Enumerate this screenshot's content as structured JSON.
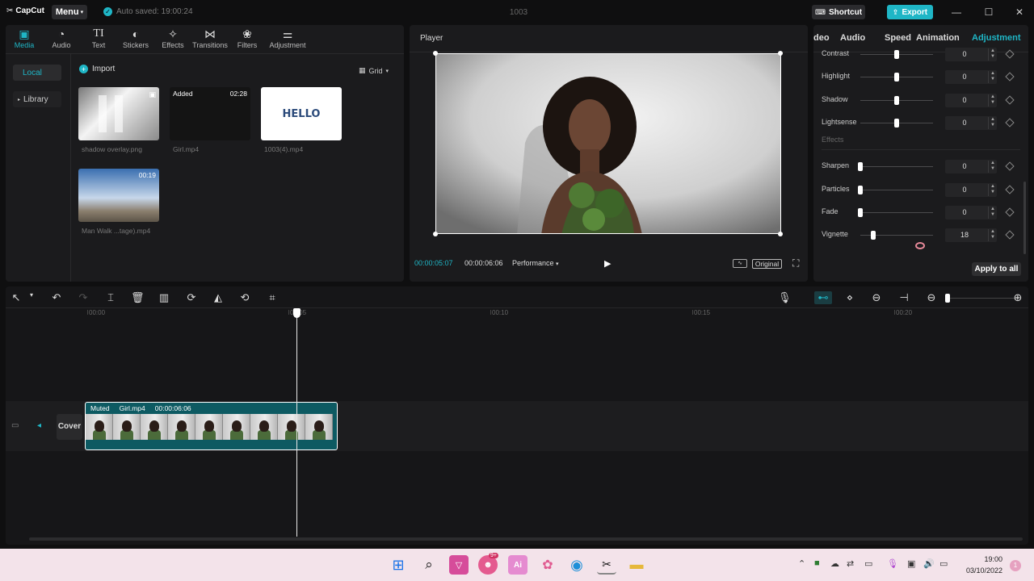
{
  "app": {
    "logo": "CapCut",
    "menu_label": "Menu",
    "autosave": "Auto saved: 19:00:24",
    "project_title": "1003",
    "shortcut_label": "Shortcut",
    "export_label": "Export"
  },
  "tool_tabs": [
    {
      "label": "Media",
      "icon": "media-icon",
      "active": true
    },
    {
      "label": "Audio",
      "icon": "audio-icon"
    },
    {
      "label": "Text",
      "icon": "text-icon"
    },
    {
      "label": "Stickers",
      "icon": "stickers-icon"
    },
    {
      "label": "Effects",
      "icon": "effects-icon"
    },
    {
      "label": "Transitions",
      "icon": "transitions-icon"
    },
    {
      "label": "Filters",
      "icon": "filters-icon"
    },
    {
      "label": "Adjustment",
      "icon": "adjustment-icon"
    }
  ],
  "media": {
    "side": [
      "Local",
      "Library"
    ],
    "import_label": "Import",
    "view_label": "Grid",
    "items": [
      {
        "name": "shadow overlay.png",
        "duration": "",
        "added": ""
      },
      {
        "name": "Girl.mp4",
        "duration": "02:28",
        "added": "Added"
      },
      {
        "name": "1003(4).mp4",
        "duration": "",
        "added": "",
        "text": "HELLO"
      },
      {
        "name": "Man Walk ...tage).mp4",
        "duration": "00:19",
        "added": ""
      }
    ]
  },
  "player": {
    "title": "Player",
    "current_time": "00:00:05:07",
    "total_time": "00:00:06:06",
    "performance_label": "Performance",
    "original_label": "Original"
  },
  "adjustment": {
    "tabs": [
      "deo",
      "Audio",
      "Speed",
      "Animation",
      "Adjustment"
    ],
    "active_tab": "Adjustment",
    "rows_top": [
      {
        "label": "Contrast",
        "value": "0",
        "level": 0.5
      },
      {
        "label": "Highlight",
        "value": "0",
        "level": 0.5
      },
      {
        "label": "Shadow",
        "value": "0",
        "level": 0.5
      },
      {
        "label": "Lightsense",
        "value": "0",
        "level": 0.5
      }
    ],
    "effects_heading": "Effects",
    "rows_effects": [
      {
        "label": "Sharpen",
        "value": "0",
        "level": 0
      },
      {
        "label": "Particles",
        "value": "0",
        "level": 0
      },
      {
        "label": "Fade",
        "value": "0",
        "level": 0
      },
      {
        "label": "Vignette",
        "value": "18",
        "level": 0.18
      }
    ],
    "apply_label": "Apply to all"
  },
  "timeline": {
    "ruler": [
      "00:00",
      "00:05",
      "00:10",
      "00:15",
      "00:20"
    ],
    "cover_label": "Cover",
    "clip": {
      "muted": "Muted",
      "name": "Girl.mp4",
      "duration": "00:00:06:06"
    }
  },
  "taskbar": {
    "time": "19:00",
    "date": "03/10/2022",
    "notifications": "1",
    "chat_badge": "9+"
  },
  "colors": {
    "accent": "#1fb6c6",
    "clip": "#0d5a62"
  }
}
